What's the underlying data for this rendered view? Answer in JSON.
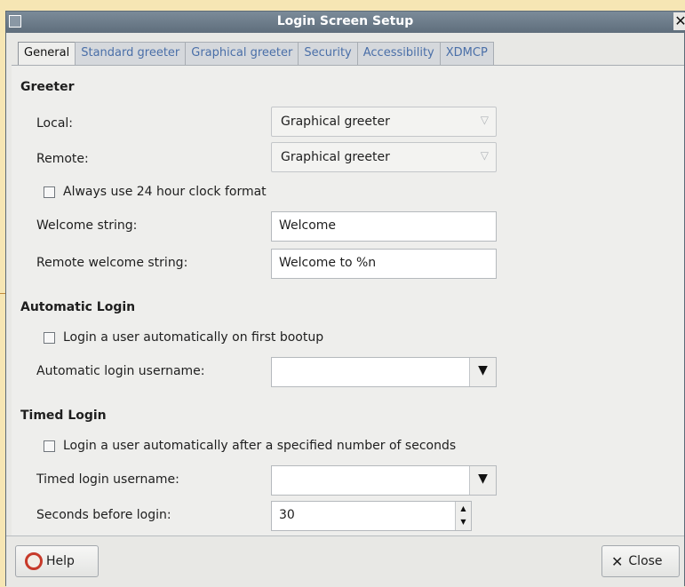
{
  "window": {
    "title": "Login Screen Setup",
    "close_glyph": "✕"
  },
  "tabs": [
    {
      "label": "General",
      "active": true
    },
    {
      "label": "Standard greeter"
    },
    {
      "label": "Graphical greeter"
    },
    {
      "label": "Security"
    },
    {
      "label": "Accessibility"
    },
    {
      "label": "XDMCP"
    }
  ],
  "greeter": {
    "heading": "Greeter",
    "local_label": "Local:",
    "local_value": "Graphical greeter",
    "remote_label": "Remote:",
    "remote_value": "Graphical greeter",
    "clock_checkbox": "Always use 24 hour clock format",
    "welcome_label": "Welcome string:",
    "welcome_value": "Welcome",
    "remote_welcome_label": "Remote welcome string:",
    "remote_welcome_value": "Welcome to %n"
  },
  "automatic_login": {
    "heading": "Automatic Login",
    "checkbox": "Login a user automatically on first bootup",
    "username_label": "Automatic login username:",
    "username_value": ""
  },
  "timed_login": {
    "heading": "Timed Login",
    "checkbox": "Login a user automatically after a specified number of seconds",
    "username_label": "Timed login username:",
    "username_value": "",
    "seconds_label": "Seconds before login:",
    "seconds_value": "30"
  },
  "buttons": {
    "help": "Help",
    "close": "Close"
  },
  "icons": {
    "help": "help-lifebuoy-icon",
    "close": "close-x-icon",
    "dropdown": "triangle-down-icon"
  },
  "colors": {
    "titlebar": "#6c7b89",
    "tab_text": "#4a6fa8",
    "help_icon": "#c73a2a"
  }
}
